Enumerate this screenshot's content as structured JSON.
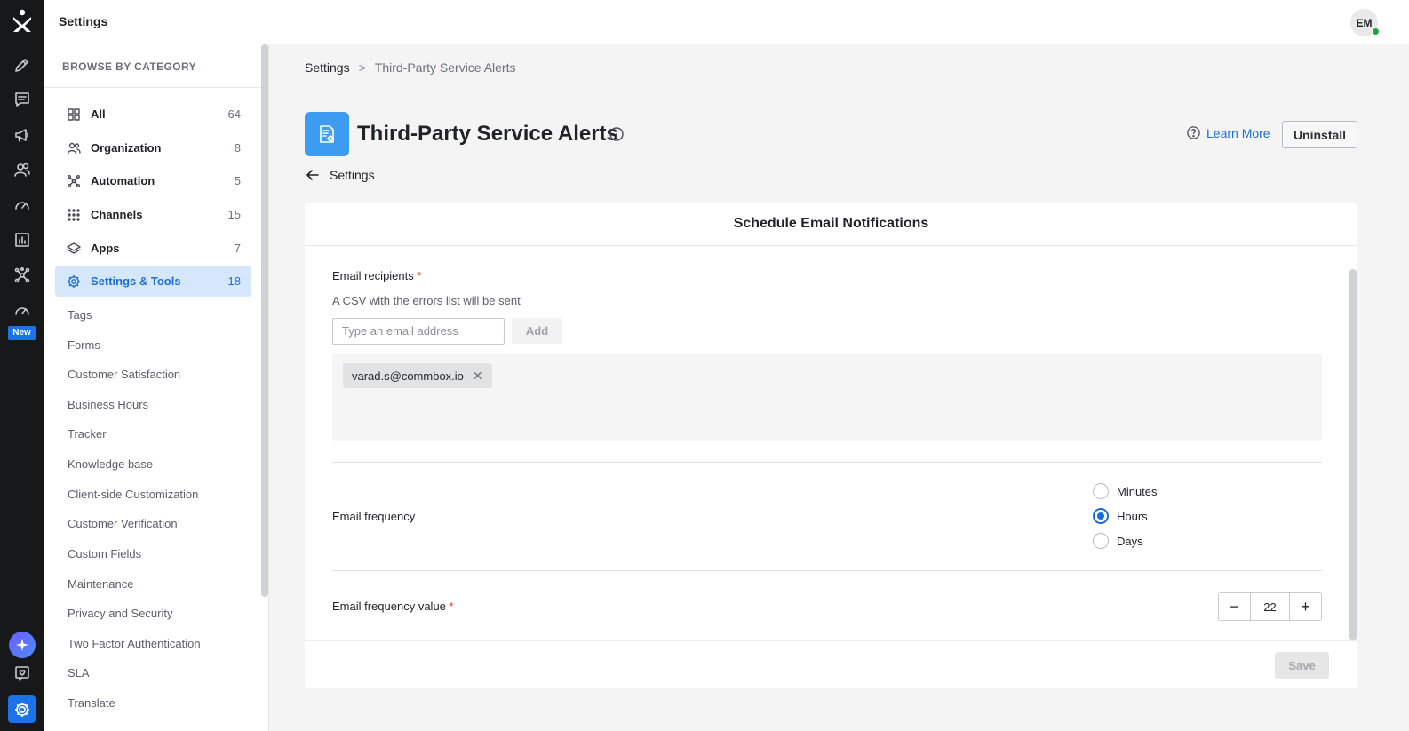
{
  "topbar": {
    "title": "Settings",
    "avatar_initials": "EM",
    "presence_color": "#1fa34a"
  },
  "rail": {
    "new_badge": "New",
    "accent": "#1a73e8"
  },
  "sidebar": {
    "heading": "BROWSE BY CATEGORY",
    "categories": [
      {
        "label": "All",
        "count": "64",
        "icon": "grid-icon"
      },
      {
        "label": "Organization",
        "count": "8",
        "icon": "users-icon"
      },
      {
        "label": "Automation",
        "count": "5",
        "icon": "network-icon"
      },
      {
        "label": "Channels",
        "count": "15",
        "icon": "dots-grid-icon"
      },
      {
        "label": "Apps",
        "count": "7",
        "icon": "layers-icon"
      },
      {
        "label": "Settings & Tools",
        "count": "18",
        "icon": "gear-icon",
        "active": true
      }
    ],
    "subitems": [
      "Tags",
      "Forms",
      "Customer Satisfaction",
      "Business Hours",
      "Tracker",
      "Knowledge base",
      "Client-side Customization",
      "Customer Verification",
      "Custom Fields",
      "Maintenance",
      "Privacy and Security",
      "Two Factor Authentication",
      "SLA",
      "Translate"
    ]
  },
  "breadcrumb": {
    "root": "Settings",
    "separator": ">",
    "current": "Third-Party Service Alerts"
  },
  "app": {
    "title": "Third-Party Service Alerts",
    "learn_more": "Learn More",
    "uninstall": "Uninstall",
    "back_label": "Settings",
    "icon_color": "#3d9bf0"
  },
  "form": {
    "title": "Schedule Email Notifications",
    "recipients_label": "Email recipients",
    "required_mark": "*",
    "recipients_hint": "A CSV with the errors list will be sent",
    "email_placeholder": "Type an email address",
    "add_label": "Add",
    "chips": [
      "varad.s@commbox.io"
    ],
    "chip_remove": "✕",
    "frequency_label": "Email frequency",
    "frequency_options": [
      "Minutes",
      "Hours",
      "Days"
    ],
    "frequency_selected": "Hours",
    "frequency_value_label": "Email frequency value",
    "frequency_value": "22",
    "minus": "−",
    "plus": "+",
    "save_label": "Save"
  }
}
